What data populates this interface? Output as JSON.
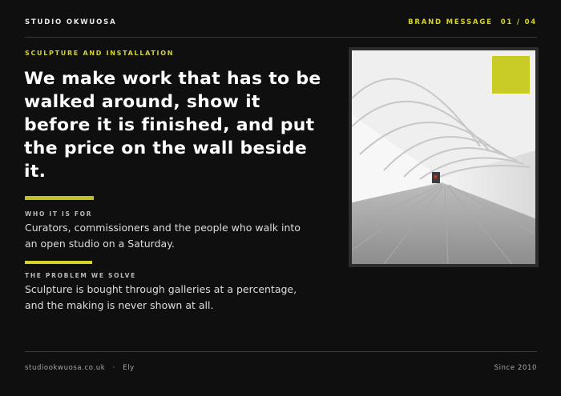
{
  "header": {
    "brand": "STUDIO OKWUOSA",
    "section": "BRAND MESSAGE",
    "page": "01 / 04"
  },
  "eyebrow": "SCULPTURE AND INSTALLATION",
  "headline": "We make work that has to be walked around, show it before it is finished, and put the price on the wall beside it.",
  "audience": {
    "label": "WHO IT IS FOR",
    "text": "Curators, commissioners and the people who walk into an open studio on a Saturday."
  },
  "problem": {
    "label": "THE PROBLEM WE SOLVE",
    "text": "Sculpture is bought through galleries at a percentage, and the making is never shown at all."
  },
  "footer": {
    "website": "studiookwuosa.co.uk",
    "separator": "·",
    "location": "Ely",
    "since": "Since 2010"
  },
  "colors": {
    "background": "#0f0f10",
    "accent": "#d4d327",
    "text": "#ffffff"
  }
}
